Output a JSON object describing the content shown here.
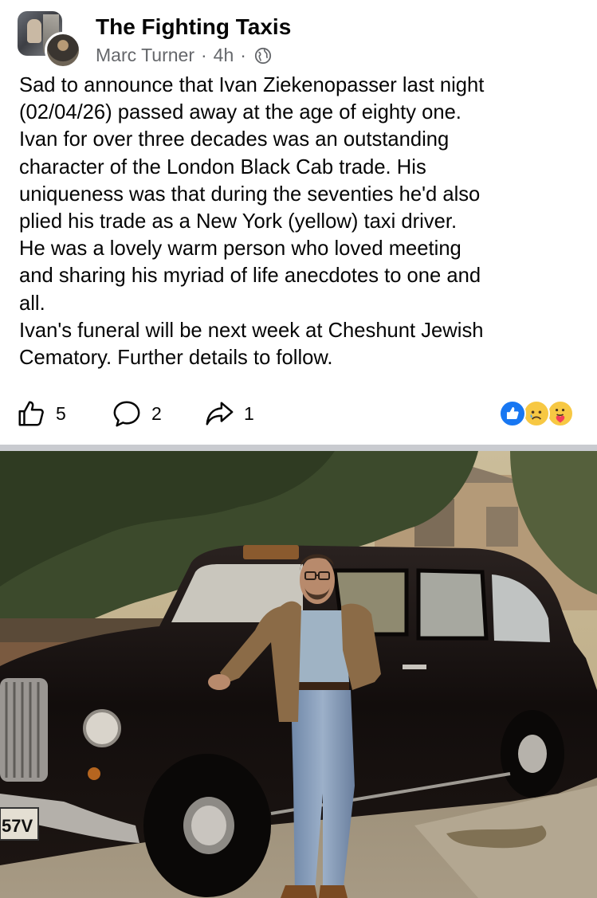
{
  "group": {
    "name": "The Fighting Taxis",
    "author": "Marc Turner",
    "separator": "·",
    "time": "4h",
    "audience_icon": "globe-icon"
  },
  "post": {
    "lines": [
      "Sad to announce that Ivan Ziekenopasser last night",
      "(02/04/26) passed away at the age of eighty one.",
      "Ivan for over three decades was an outstanding",
      "character of the London Black Cab trade. His",
      "uniqueness was that during the seventies he'd also",
      "plied his trade as a New York (yellow) taxi driver.",
      "He was a lovely warm person who loved meeting",
      "and sharing his myriad of life anecdotes to one and",
      "all.",
      "Ivan's funeral will be next week at Cheshunt Jewish",
      "Cematory. Further details to follow."
    ]
  },
  "actions": {
    "like_count": "5",
    "comment_count": "2",
    "share_count": "1",
    "icons": [
      "thumbs-up-icon",
      "comment-bubble-icon",
      "share-arrow-icon"
    ]
  },
  "reactions": {
    "types": [
      "like",
      "sad",
      "care"
    ],
    "colors": {
      "like": "#1877f2",
      "sad": "#f7c843",
      "care": "#f7c843"
    }
  },
  "photo": {
    "plate_text": "57V"
  },
  "colors": {
    "text": "#050505",
    "secondary": "#65676b",
    "divider": "#c9cbd0"
  }
}
